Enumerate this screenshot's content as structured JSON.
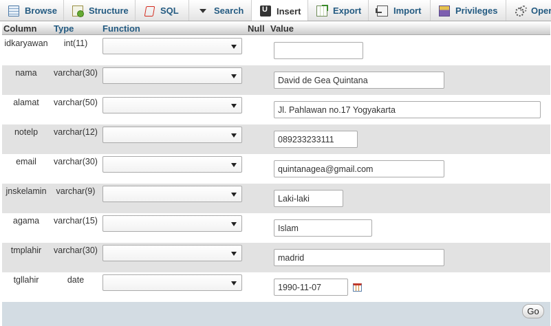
{
  "tabs": [
    {
      "label": "Browse",
      "icon": "browse-icon",
      "active": false
    },
    {
      "label": "Structure",
      "icon": "structure-icon",
      "active": false
    },
    {
      "label": "SQL",
      "icon": "sql-icon",
      "active": false
    },
    {
      "label": "Search",
      "icon": "search-icon",
      "active": false
    },
    {
      "label": "Insert",
      "icon": "insert-icon",
      "active": true
    },
    {
      "label": "Export",
      "icon": "export-icon",
      "active": false
    },
    {
      "label": "Import",
      "icon": "import-icon",
      "active": false
    },
    {
      "label": "Privileges",
      "icon": "privileges-icon",
      "active": false
    },
    {
      "label": "Operations",
      "icon": "operations-icon",
      "active": false
    }
  ],
  "table_header": {
    "column": "Column",
    "type": "Type",
    "function": "Function",
    "null": "Null",
    "value": "Value"
  },
  "rows": [
    {
      "column": "idkaryawan",
      "type": "int(11)",
      "function": "",
      "value": ""
    },
    {
      "column": "nama",
      "type": "varchar(30)",
      "function": "",
      "value": "David de Gea Quintana"
    },
    {
      "column": "alamat",
      "type": "varchar(50)",
      "function": "",
      "value": "Jl. Pahlawan no.17 Yogyakarta"
    },
    {
      "column": "notelp",
      "type": "varchar(12)",
      "function": "",
      "value": "089233233111"
    },
    {
      "column": "email",
      "type": "varchar(30)",
      "function": "",
      "value": "quintanagea@gmail.com"
    },
    {
      "column": "jnskelamin",
      "type": "varchar(9)",
      "function": "",
      "value": "Laki-laki"
    },
    {
      "column": "agama",
      "type": "varchar(15)",
      "function": "",
      "value": "Islam"
    },
    {
      "column": "tmplahir",
      "type": "varchar(30)",
      "function": "",
      "value": "madrid"
    },
    {
      "column": "tgllahir",
      "type": "date",
      "function": "",
      "value": "1990-11-07"
    }
  ],
  "footer": {
    "go_label": "Go"
  },
  "colors": {
    "link": "#235a81",
    "row_alt": "#e2e2e2",
    "footer_bg": "#d3dce3"
  }
}
